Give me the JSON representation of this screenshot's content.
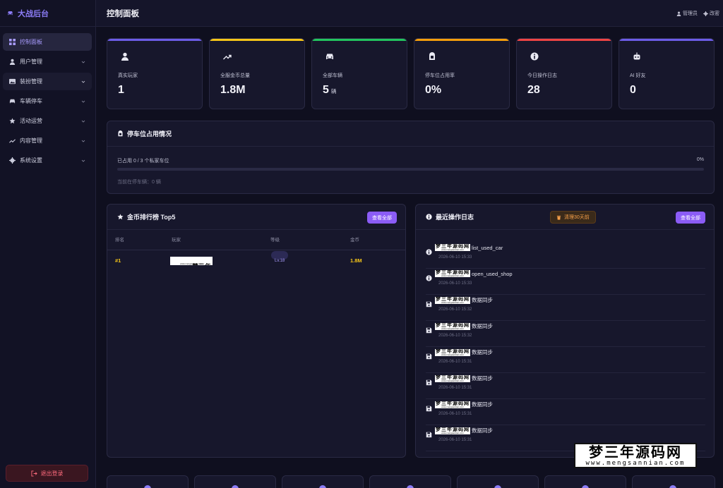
{
  "brand": {
    "title": "大战后台"
  },
  "sidebar": {
    "items": [
      {
        "label": "控制面板",
        "icon": "dashboard-icon"
      },
      {
        "label": "用户管理",
        "icon": "user-icon"
      },
      {
        "label": "装扮管理",
        "icon": "image-icon"
      },
      {
        "label": "车辆停车",
        "icon": "car-icon"
      },
      {
        "label": "活动运营",
        "icon": "star-icon"
      },
      {
        "label": "内容管理",
        "icon": "trend-icon"
      },
      {
        "label": "系统设置",
        "icon": "gear-icon"
      }
    ],
    "logout_label": "退出登录"
  },
  "header": {
    "title": "控制面板",
    "user_label": "管理员",
    "settings_label": "改密"
  },
  "stats": [
    {
      "label": "真实玩家",
      "value": "1",
      "unit": "",
      "color": "#6c5ce7",
      "icon": "user-icon"
    },
    {
      "label": "全服金币总量",
      "value": "1.8M",
      "unit": "",
      "color": "#f5c518",
      "icon": "trending-up-icon"
    },
    {
      "label": "全部车辆",
      "value": "5",
      "unit": "辆",
      "color": "#22c55e",
      "icon": "car-icon"
    },
    {
      "label": "停车位占用率",
      "value": "0%",
      "unit": "",
      "color": "#f59e0b",
      "icon": "parking-icon"
    },
    {
      "label": "今日操作日志",
      "value": "28",
      "unit": "",
      "color": "#ef4444",
      "icon": "info-icon"
    },
    {
      "label": "AI 好友",
      "value": "0",
      "unit": "",
      "color": "#6c5ce7",
      "icon": "robot-icon"
    }
  ],
  "parking": {
    "title": "停车位占用情况",
    "occupied_text": "已占用 0 / 3 个私家车位",
    "percent_text": "0%",
    "fill_fraction": 0,
    "current_text": "当前在停车辆：0 辆"
  },
  "ranking": {
    "title": "金币排行榜 Top5",
    "view_all": "查看全部",
    "columns": [
      "排名",
      "玩家",
      "等级",
      "金币"
    ],
    "rows": [
      {
        "rank": "#1",
        "player_wm": "梦三年源码网",
        "player_wm_sub": "www.mengsannian.com",
        "level": "Lv.18",
        "coins": "1.8M"
      }
    ]
  },
  "logs": {
    "title": "最近操作日志",
    "clean_label": "清理30天前",
    "view_all": "查看全部",
    "items": [
      {
        "icon": "info-icon",
        "wm": "梦三年源码网",
        "action": "list_used_car",
        "time": "2026-06-10 15:33"
      },
      {
        "icon": "info-icon",
        "wm": "梦三年源码网",
        "action": "open_used_shop",
        "time": "2026-06-10 15:33"
      },
      {
        "icon": "save-icon",
        "wm": "梦三年源码网",
        "action": "数据同步",
        "time": "2026-06-10 15:32"
      },
      {
        "icon": "save-icon",
        "wm": "梦三年源码网",
        "action": "数据同步",
        "time": "2026-06-10 15:32"
      },
      {
        "icon": "save-icon",
        "wm": "梦三年源码网",
        "action": "数据同步",
        "time": "2026-06-10 15:31"
      },
      {
        "icon": "save-icon",
        "wm": "梦三年源码网",
        "action": "数据同步",
        "time": "2026-06-10 15:31"
      },
      {
        "icon": "save-icon",
        "wm": "梦三年源码网",
        "action": "数据同步",
        "time": "2026-06-10 15:31"
      },
      {
        "icon": "save-icon",
        "wm": "梦三年源码网",
        "action": "数据同步",
        "time": "2026-06-10 15:31"
      }
    ]
  },
  "watermark": {
    "title": "梦三年源码网",
    "url": "www.mengsannian.com"
  }
}
